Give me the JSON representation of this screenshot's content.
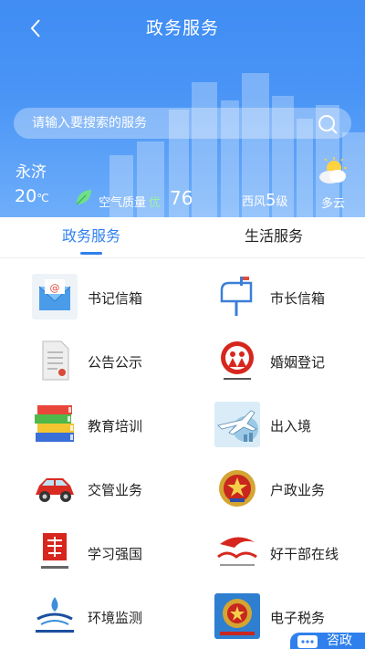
{
  "header": {
    "title": "政务服务"
  },
  "search": {
    "placeholder": "请输入要搜索的服务"
  },
  "weather": {
    "city": "永济",
    "temperature": "20",
    "temperature_unit": "℃",
    "air_quality_label": "空气质量",
    "air_quality_level": "优",
    "air_quality_value": "76",
    "wind_direction": "西风",
    "wind_level": "5",
    "wind_unit": "级",
    "condition": "多云"
  },
  "tabs": [
    {
      "label": "政务服务",
      "active": true
    },
    {
      "label": "生活服务",
      "active": false
    }
  ],
  "services": [
    {
      "label": "书记信箱",
      "icon": "mail-envelope-icon"
    },
    {
      "label": "市长信箱",
      "icon": "mailbox-icon"
    },
    {
      "label": "公告公示",
      "icon": "document-icon"
    },
    {
      "label": "婚姻登记",
      "icon": "marriage-emblem-icon"
    },
    {
      "label": "教育培训",
      "icon": "books-icon"
    },
    {
      "label": "出入境",
      "icon": "airplane-icon"
    },
    {
      "label": "交管业务",
      "icon": "car-icon"
    },
    {
      "label": "户政业务",
      "icon": "police-badge-icon"
    },
    {
      "label": "学习强国",
      "icon": "xuexi-logo-icon"
    },
    {
      "label": "好干部在线",
      "icon": "cadre-online-logo-icon"
    },
    {
      "label": "环境监测",
      "icon": "environment-logo-icon"
    },
    {
      "label": "电子税务",
      "icon": "tax-emblem-icon"
    }
  ],
  "consult_button": {
    "label": "咨政"
  },
  "colors": {
    "accent": "#2f80ed",
    "hero": "#4a95f6"
  }
}
